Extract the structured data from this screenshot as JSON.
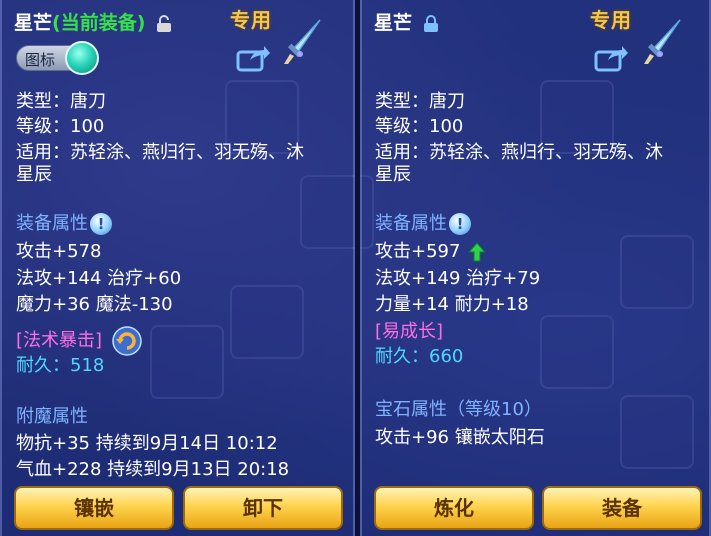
{
  "left": {
    "title_name": "星芒",
    "title_tag": "(当前装备)",
    "exclusive_label": "专用",
    "icon_toggle_label": "图标",
    "type_line": "类型：唐刀",
    "level_line": "等级：100",
    "usable_line1": "适用：苏轻涂、燕归行、羽无殇、沐",
    "usable_line2": "星辰",
    "attr_header": "装备属性",
    "attrs": [
      "攻击+578",
      "法攻+144 治疗+60",
      "魔力+36 魔法-130"
    ],
    "special": "[法术暴击]",
    "durability": "耐久：518",
    "enchant_header": "附魔属性",
    "enchants": [
      "物抗+35 持续到9月14日 10:12",
      "气血+228 持续到9月13日 20:18"
    ],
    "buttons": [
      "镶嵌",
      "卸下"
    ]
  },
  "right": {
    "title_name": "星芒",
    "exclusive_label": "专用",
    "type_line": "类型：唐刀",
    "level_line": "等级：100",
    "usable_line1": "适用：苏轻涂、燕归行、羽无殇、沐",
    "usable_line2": "星辰",
    "attr_header": "装备属性",
    "attrs": [
      "攻击+597",
      "法攻+149 治疗+79",
      "力量+14 耐力+18"
    ],
    "special": "[易成长]",
    "durability": "耐久：660",
    "gem_header": "宝石属性（等级10）",
    "gem_line": "攻击+96 镶嵌太阳石",
    "buttons": [
      "炼化",
      "装备"
    ]
  },
  "colors": {
    "title": "#ffffff",
    "current_tag": "#36e04b",
    "section": "#7fb3ff",
    "special": "#ff6ee6",
    "durability": "#4fd8ff",
    "exclusive": "#f6c84a",
    "button": "#ffd34f"
  },
  "icons": {
    "lock_open": "open-lock-icon",
    "lock_closed": "lock-icon",
    "share": "share-icon",
    "weapon": "blade-icon",
    "info": "info-icon",
    "refresh": "refresh-icon",
    "up_arrow": "up-arrow-icon"
  }
}
